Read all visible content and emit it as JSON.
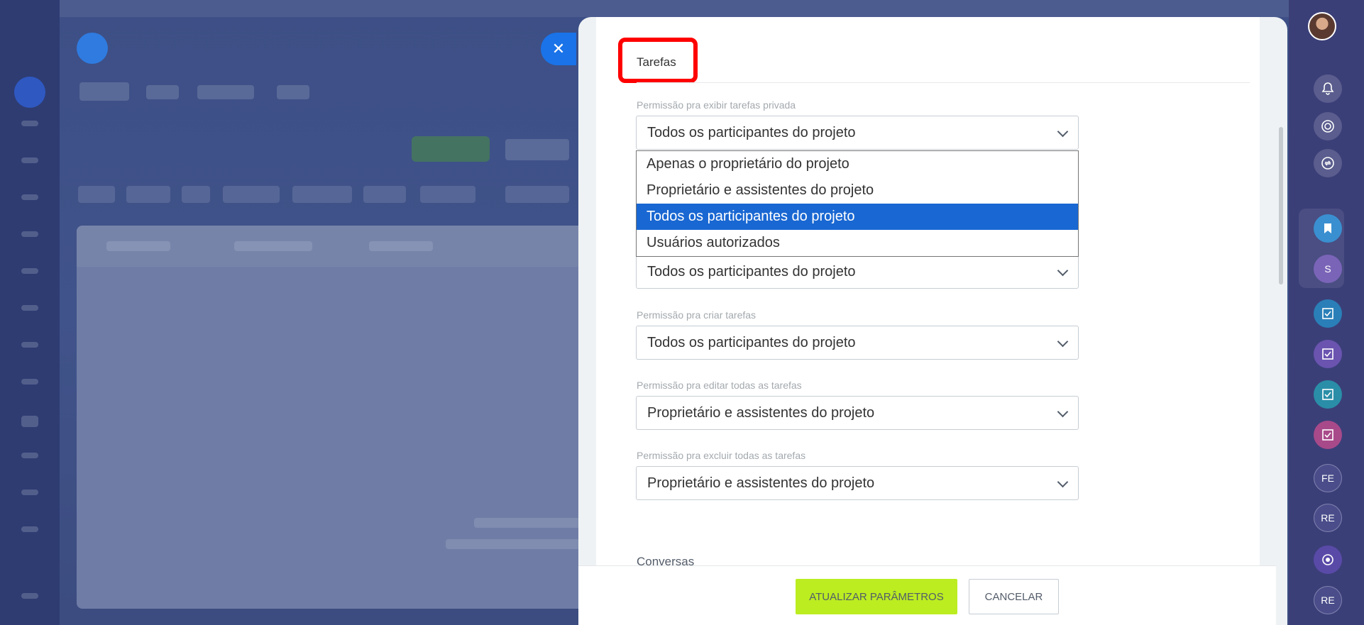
{
  "panel": {
    "section_title": "Tarefas",
    "close_icon": "close-icon"
  },
  "fields": [
    {
      "label": "Permissão pra exibir tarefas privada",
      "value": "Todos os participantes do projeto"
    },
    {
      "label": "",
      "value": "Todos os participantes do projeto"
    },
    {
      "label": "Permissão pra criar tarefas",
      "value": "Todos os participantes do projeto"
    },
    {
      "label": "Permissão pra editar todas as tarefas",
      "value": "Proprietário e assistentes do projeto"
    },
    {
      "label": "Permissão pra excluir todas as tarefas",
      "value": "Proprietário e assistentes do projeto"
    }
  ],
  "dropdown": {
    "options": [
      "Apenas o proprietário do projeto",
      "Proprietário e assistentes do projeto",
      "Todos os participantes do projeto",
      "Usuários autorizados"
    ],
    "selected_index": 2
  },
  "next_section": "Conversas",
  "footer": {
    "update_label": "ATUALIZAR PARÂMETROS",
    "cancel_label": "CANCELAR"
  },
  "right_rail": {
    "items": [
      "S",
      "FE",
      "RE",
      "RE"
    ]
  },
  "colors": {
    "accent": "#1967d2",
    "update_button": "#bbed21",
    "highlight": "#ff0000"
  }
}
